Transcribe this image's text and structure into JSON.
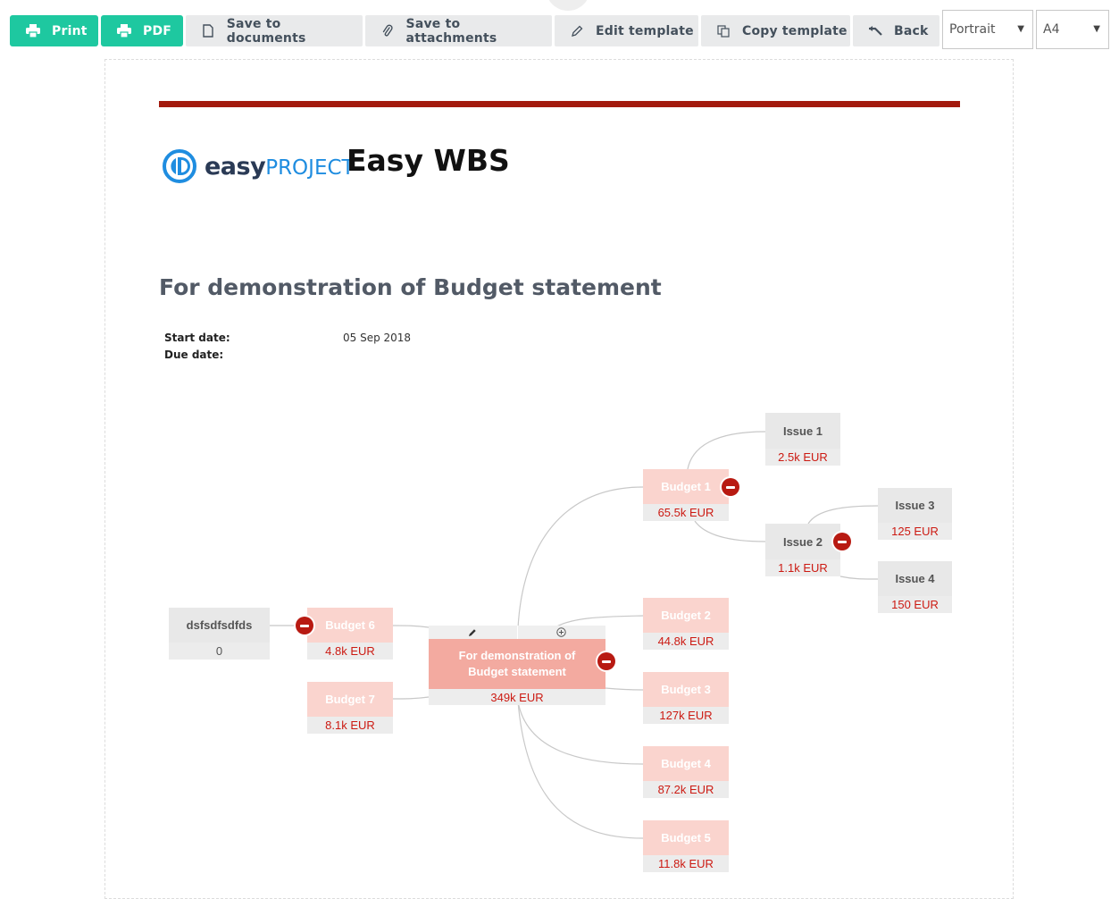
{
  "toolbar": {
    "print_label": "Print",
    "pdf_label": "PDF",
    "save_documents_label": "Save to documents",
    "save_attachments_label": "Save to attachments",
    "edit_template_label": "Edit template",
    "copy_template_label": "Copy template",
    "back_label": "Back",
    "orientation_value": "Portrait",
    "paper_size_value": "A4"
  },
  "colors": {
    "accent_green": "#1ec8a0",
    "brand_red": "#a31a0e",
    "value_red": "#cc1a12",
    "collapse_red": "#b81a12",
    "budget_fill": "#fad4ce",
    "root_fill": "#f3aaa0"
  },
  "header": {
    "logo_text_strong": "easy",
    "logo_text_light": "PROJECT",
    "app_title": "Easy WBS"
  },
  "document": {
    "title": "For demonstration of Budget statement",
    "start_date_label": "Start date:",
    "start_date_value": "05 Sep 2018",
    "due_date_label": "Due date:",
    "due_date_value": ""
  },
  "wbs": {
    "root": {
      "title": "For demonstration of Budget statement",
      "value": "349k EUR"
    },
    "nodes": {
      "budget1": {
        "title": "Budget 1",
        "value": "65.5k EUR"
      },
      "budget2": {
        "title": "Budget 2",
        "value": "44.8k EUR"
      },
      "budget3": {
        "title": "Budget 3",
        "value": "127k EUR"
      },
      "budget4": {
        "title": "Budget 4",
        "value": "87.2k EUR"
      },
      "budget5": {
        "title": "Budget 5",
        "value": "11.8k EUR"
      },
      "budget6": {
        "title": "Budget 6",
        "value": "4.8k EUR"
      },
      "budget7": {
        "title": "Budget 7",
        "value": "8.1k EUR"
      },
      "issue1": {
        "title": "Issue 1",
        "value": "2.5k EUR"
      },
      "issue2": {
        "title": "Issue 2",
        "value": "1.1k EUR"
      },
      "issue3": {
        "title": "Issue 3",
        "value": "125 EUR"
      },
      "issue4": {
        "title": "Issue 4",
        "value": "150 EUR"
      },
      "dsf": {
        "title": "dsfsdfsdfds",
        "value": "0"
      }
    }
  }
}
